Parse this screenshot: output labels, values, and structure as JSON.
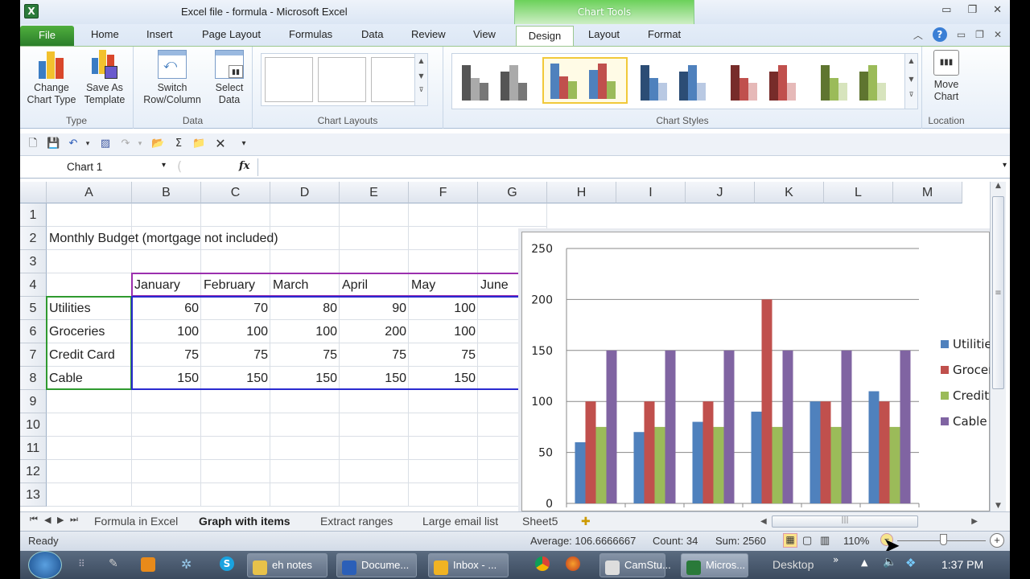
{
  "window": {
    "title": "Excel file - formula  -  Microsoft Excel",
    "app_icon": "excel-icon"
  },
  "contextual": {
    "label": "Chart Tools"
  },
  "tabs": [
    "File",
    "Home",
    "Insert",
    "Page Layout",
    "Formulas",
    "Data",
    "Review",
    "View",
    "Design",
    "Layout",
    "Format"
  ],
  "active_tab": "Design",
  "ribbon": {
    "groups": [
      {
        "label": "Type",
        "buttons": [
          "Change Chart Type",
          "Save As Template"
        ]
      },
      {
        "label": "Data",
        "buttons": [
          "Switch Row/Column",
          "Select Data"
        ]
      },
      {
        "label": "Chart Layouts"
      },
      {
        "label": "Chart Styles"
      },
      {
        "label": "Location",
        "buttons": [
          "Move Chart"
        ]
      }
    ],
    "btn": {
      "change1": "Change",
      "change2": "Chart Type",
      "save1": "Save As",
      "save2": "Template",
      "switch1": "Switch",
      "switch2": "Row/Column",
      "select1": "Select",
      "select2": "Data",
      "move1": "Move",
      "move2": "Chart"
    },
    "selected_style_index": 1
  },
  "formula_bar": {
    "name_box": "Chart 1",
    "fx": "fx",
    "value": ""
  },
  "columns": [
    "A",
    "B",
    "C",
    "D",
    "E",
    "F",
    "G",
    "H",
    "I",
    "J",
    "K",
    "L",
    "M"
  ],
  "rows": [
    "1",
    "2",
    "3",
    "4",
    "5",
    "6",
    "7",
    "8",
    "9",
    "10",
    "11",
    "12",
    "13"
  ],
  "sheet": {
    "title": "Monthly Budget (mortgage not included)",
    "months": [
      "January",
      "February",
      "March",
      "April",
      "May",
      "June"
    ],
    "items": [
      {
        "label": "Utilities",
        "values": [
          "60",
          "70",
          "80",
          "90",
          "100"
        ]
      },
      {
        "label": "Groceries",
        "values": [
          "100",
          "100",
          "100",
          "200",
          "100"
        ]
      },
      {
        "label": "Credit Card",
        "values": [
          "75",
          "75",
          "75",
          "75",
          "75"
        ]
      },
      {
        "label": "Cable",
        "values": [
          "150",
          "150",
          "150",
          "150",
          "150"
        ]
      }
    ]
  },
  "chart_data": {
    "type": "bar",
    "categories": [
      "January",
      "February",
      "March",
      "April",
      "May",
      "June"
    ],
    "series": [
      {
        "name": "Utilities",
        "legend_text": "Utilitie",
        "color": "#4f81bd",
        "values": [
          60,
          70,
          80,
          90,
          100,
          110
        ]
      },
      {
        "name": "Groceries",
        "legend_text": "Grocer",
        "color": "#c0504d",
        "values": [
          100,
          100,
          100,
          200,
          100,
          100
        ]
      },
      {
        "name": "Credit Card",
        "legend_text": "Credit",
        "color": "#9bbb59",
        "values": [
          75,
          75,
          75,
          75,
          75,
          75
        ]
      },
      {
        "name": "Cable",
        "legend_text": "Cable",
        "color": "#8064a2",
        "values": [
          150,
          150,
          150,
          150,
          150,
          150
        ]
      }
    ],
    "yticks": [
      0,
      50,
      100,
      150,
      200,
      250
    ],
    "ylim": [
      0,
      250
    ],
    "grid": true,
    "title": "",
    "xlabel": "",
    "ylabel": "",
    "legend": "right"
  },
  "sheet_tabs": [
    "Formula in Excel",
    "Graph with items",
    "Extract ranges",
    "Large email list",
    "Sheet5"
  ],
  "active_sheet": "Graph with items",
  "status": {
    "ready": "Ready",
    "average": "Average: 106.6666667",
    "count": "Count: 34",
    "sum": "Sum: 2560",
    "zoom": "110%"
  },
  "taskbar": {
    "items": [
      "eh notes",
      "Docume...",
      "Inbox - ...",
      "CamStu...",
      "Micros..."
    ],
    "desktop": "Desktop",
    "clock": "1:37 PM"
  }
}
